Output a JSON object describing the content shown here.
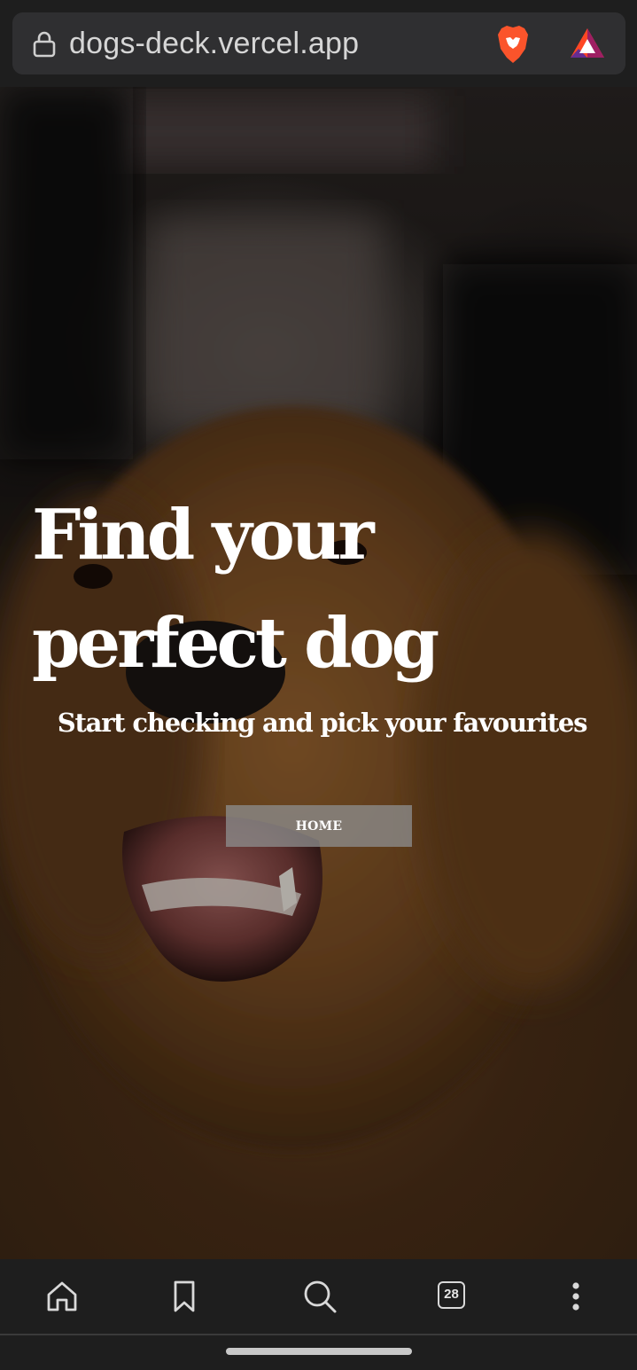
{
  "browser": {
    "url": "dogs-deck.vercel.app",
    "icons": {
      "lock": "lock-icon",
      "shields": "brave-shields-icon",
      "rewards": "brave-rewards-icon"
    }
  },
  "hero": {
    "title_line1": "Find your",
    "title_line2": "perfect dog",
    "subtitle": "Start checking and pick your favourites",
    "button_label": "HOME"
  },
  "bottom_nav": {
    "tab_count": "28",
    "icons": [
      "home-icon",
      "bookmark-icon",
      "search-icon",
      "tabs-icon",
      "more-menu-icon"
    ]
  },
  "colors": {
    "chrome_bg": "#1e1e1e",
    "url_box": "#2f2f31",
    "button_bg": "#8c8c8c",
    "text": "#ffffff"
  }
}
